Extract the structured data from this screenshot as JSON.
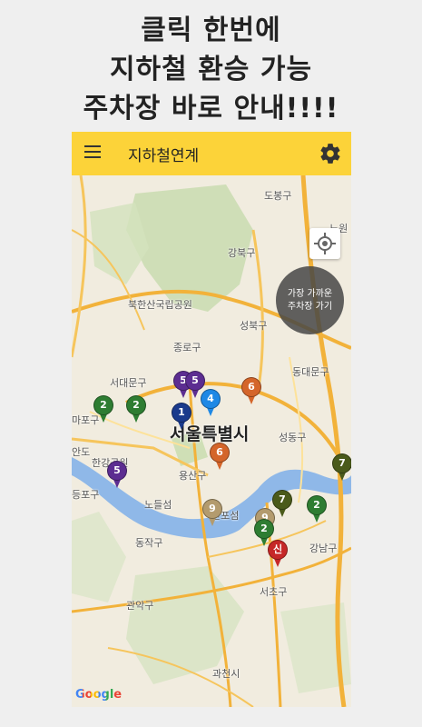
{
  "promo": {
    "line1": "클릭 한번에",
    "line2": "지하철 환승 가능",
    "line3": "주차장 바로 안내!!!!"
  },
  "toolbar": {
    "title": "지하철연계",
    "menu_icon": "menu-icon",
    "settings_icon": "gear-icon"
  },
  "map": {
    "nearest_button": {
      "line1": "가장 가까운",
      "line2": "주차장 가기"
    },
    "my_location_icon": "crosshair-icon",
    "google_logo": "Google",
    "labels": {
      "dobong": "도봉구",
      "nowon": "노원",
      "gangbuk": "강북구",
      "bukhansan": "북한산국립공원",
      "seongbuk": "성북구",
      "jongno": "종로구",
      "dongdaemun": "동대문구",
      "seodaemun": "서대문구",
      "mapo": "마포구",
      "seoul": "서울특별시",
      "seongdong": "성동구",
      "hangang": "한강공원",
      "yongsan": "용산구",
      "deungpo": "등포구",
      "nodeulseom": "노들섬",
      "heukseok": "반포섬",
      "dongjak": "동작구",
      "gangnam": "강남구",
      "gwanak": "관악구",
      "seocho": "서초구",
      "gwacheon": "과천시",
      "ando": "안도"
    },
    "pins": [
      {
        "label": "2",
        "color": "#2e7d32"
      },
      {
        "label": "2",
        "color": "#2e7d32"
      },
      {
        "label": "5",
        "color": "#5c2d91"
      },
      {
        "label": "5",
        "color": "#5c2d91"
      },
      {
        "label": "4",
        "color": "#1e88e5"
      },
      {
        "label": "1",
        "color": "#1a3a8c"
      },
      {
        "label": "6",
        "color": "#d4652a"
      },
      {
        "label": "6",
        "color": "#d4652a"
      },
      {
        "label": "5",
        "color": "#5c2d91"
      },
      {
        "label": "9",
        "color": "#b39b6e"
      },
      {
        "label": "9",
        "color": "#b39b6e"
      },
      {
        "label": "7",
        "color": "#4a5a1a"
      },
      {
        "label": "2",
        "color": "#2e7d32"
      },
      {
        "label": "2",
        "color": "#2e7d32"
      },
      {
        "label": "7",
        "color": "#4a5a1a"
      },
      {
        "label": "신",
        "color": "#c62828"
      }
    ]
  }
}
